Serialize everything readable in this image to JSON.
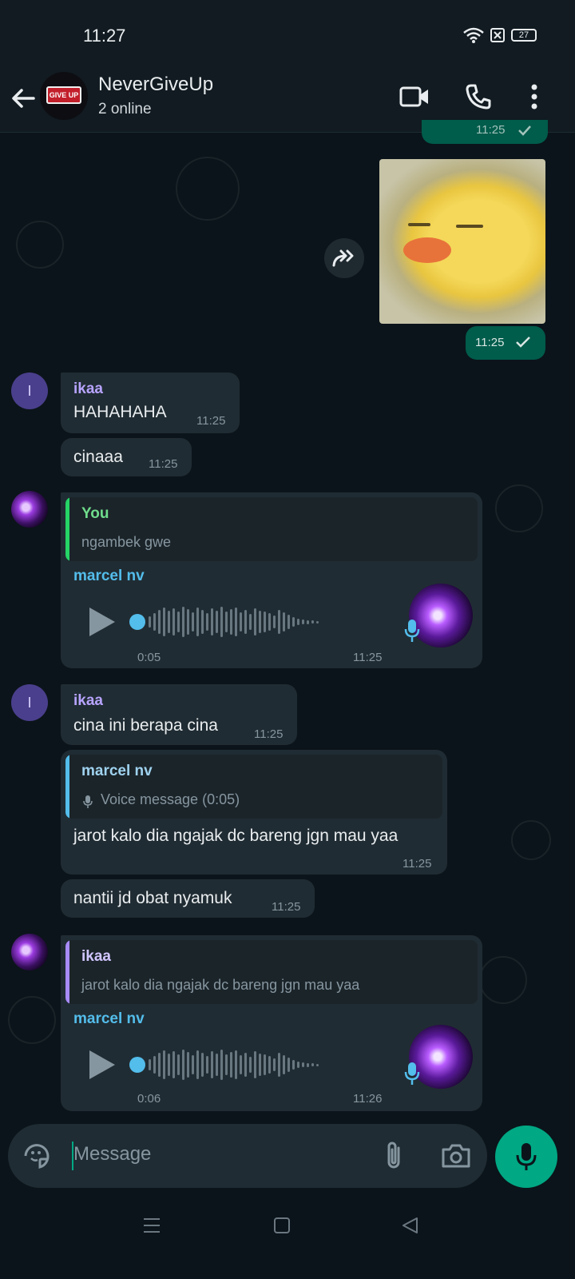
{
  "status_bar": {
    "time": "11:27",
    "battery": "27"
  },
  "header": {
    "title": "NeverGiveUp",
    "subtitle": "2 online",
    "avatar_text": "GIVE UP"
  },
  "messages": {
    "top_out_time": "11:25",
    "sticker_time": "11:25",
    "m1": {
      "sender": "ikaa",
      "avatar_letter": "I",
      "text": "HAHAHAHA",
      "time": "11:25"
    },
    "m2": {
      "text": "cinaaa",
      "time": "11:25"
    },
    "m3": {
      "quote_name": "You",
      "quote_text": "ngambek gwe",
      "sender": "marcel nv",
      "duration": "0:05",
      "time": "11:25"
    },
    "m4": {
      "sender": "ikaa",
      "avatar_letter": "I",
      "text": "cina ini berapa cina",
      "time": "11:25"
    },
    "m5": {
      "quote_name": "marcel nv",
      "quote_text": "Voice message (0:05)",
      "text": "jarot kalo dia ngajak dc bareng jgn mau yaa",
      "time": "11:25"
    },
    "m6": {
      "text": "nantii jd obat nyamuk",
      "time": "11:25"
    },
    "m7": {
      "quote_name": "ikaa",
      "quote_text": "jarot kalo dia ngajak dc bareng jgn mau yaa",
      "sender": "marcel nv",
      "duration": "0:06",
      "time": "11:26"
    }
  },
  "input": {
    "placeholder": "Message"
  },
  "icons": {
    "back": "arrow-left",
    "video": "video-camera",
    "call": "phone",
    "menu": "more-vertical",
    "forward": "forward-arrow",
    "sticker": "sticker-emoji",
    "attach": "paperclip",
    "camera": "camera",
    "mic": "microphone"
  },
  "colors": {
    "accent": "#00a884",
    "ikaa": "#b7a4ff",
    "marcel": "#53bdeb",
    "you": "#6fdc8c",
    "outgoing_bubble": "#005c4b"
  }
}
